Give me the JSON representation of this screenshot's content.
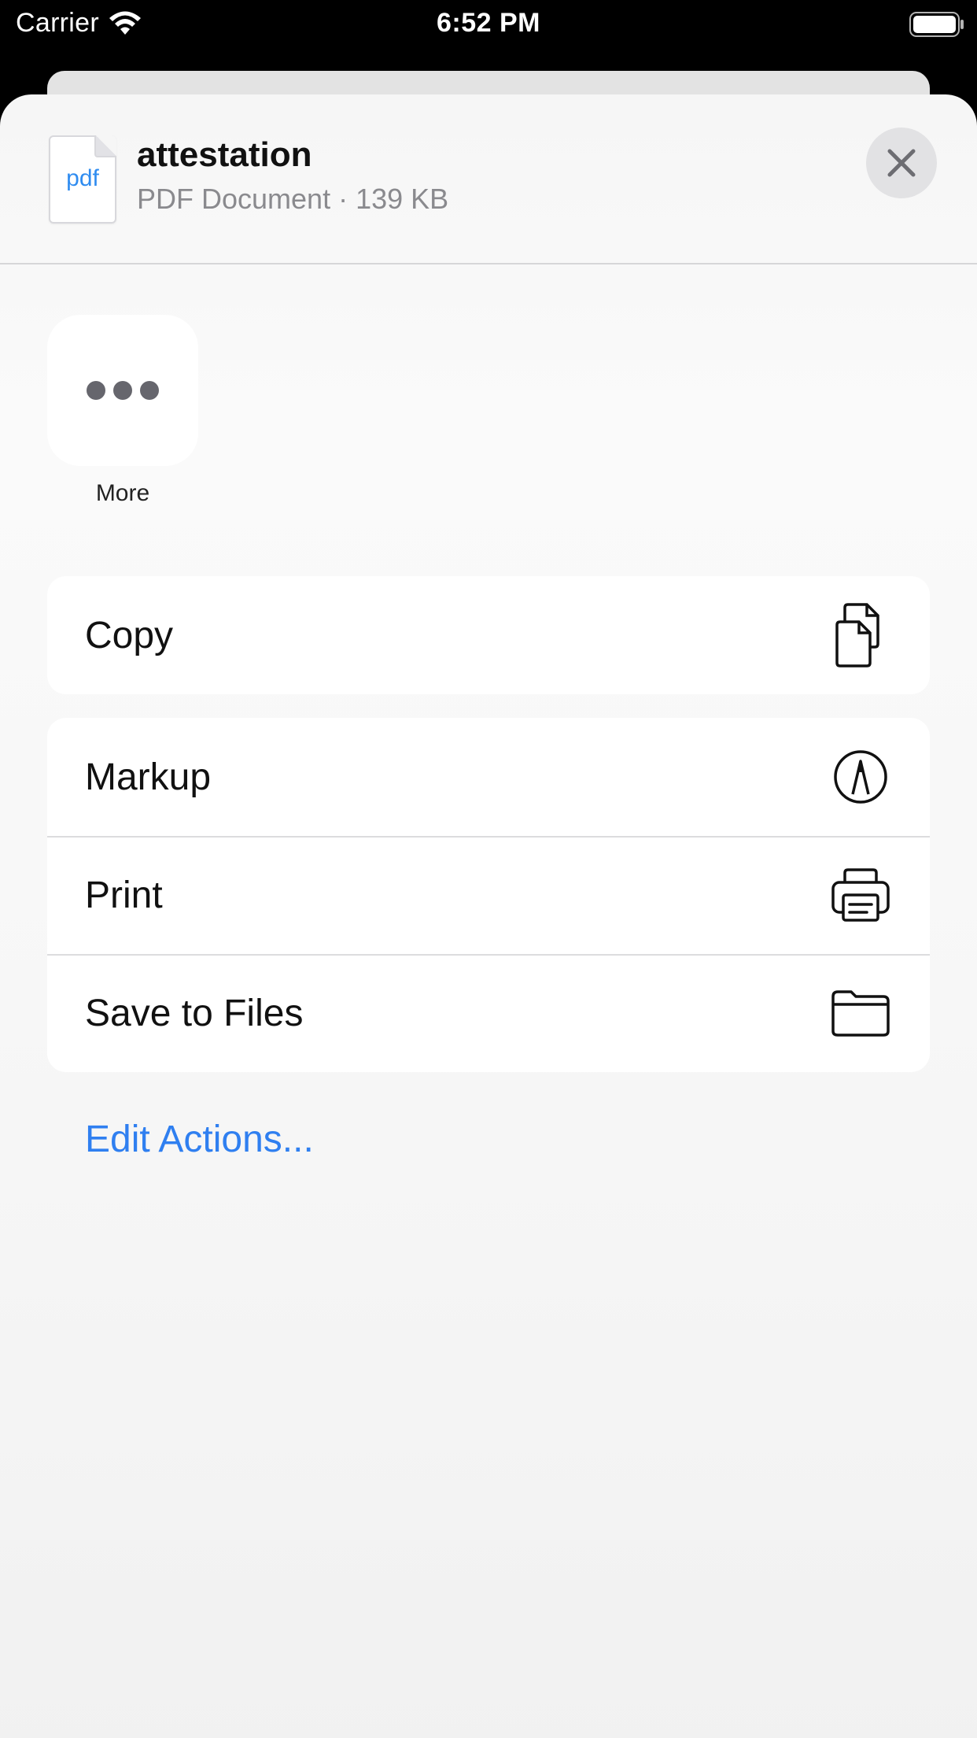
{
  "status_bar": {
    "carrier": "Carrier",
    "time": "6:52 PM"
  },
  "file": {
    "thumb_label": "pdf",
    "title": "attestation",
    "subtitle": "PDF Document · 139 KB"
  },
  "apps": [
    {
      "label": "More",
      "icon": "more-dots-icon"
    }
  ],
  "actions_group_1": [
    {
      "label": "Copy",
      "icon": "copy-icon"
    }
  ],
  "actions_group_2": [
    {
      "label": "Markup",
      "icon": "markup-pen-icon"
    },
    {
      "label": "Print",
      "icon": "printer-icon"
    },
    {
      "label": "Save to Files",
      "icon": "folder-icon"
    }
  ],
  "edit_actions_label": "Edit Actions...",
  "colors": {
    "accent": "#2f7ff0",
    "pdf_label": "#2f8cf0",
    "sheet_background": "#f6f6f6",
    "close_button_bg": "#e2e2e4"
  }
}
